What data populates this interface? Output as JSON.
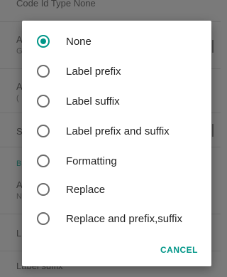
{
  "background": {
    "items": [
      {
        "title": "Code Id Type None",
        "subtitle": ""
      },
      {
        "title": "A",
        "subtitle": "G"
      },
      {
        "title": "A",
        "subtitle": "("
      },
      {
        "title": "S",
        "subtitle": ""
      },
      {
        "title": "B",
        "subtitle": ""
      },
      {
        "title": "A",
        "subtitle": "N"
      },
      {
        "title": "L",
        "subtitle": ""
      },
      {
        "title": "Label suffix",
        "subtitle": ""
      }
    ]
  },
  "dialog": {
    "selected_index": 0,
    "options": [
      {
        "label": "None"
      },
      {
        "label": "Label prefix"
      },
      {
        "label": "Label suffix"
      },
      {
        "label": "Label prefix and suffix"
      },
      {
        "label": "Formatting"
      },
      {
        "label": "Replace"
      },
      {
        "label": "Replace and prefix,suffix"
      }
    ],
    "cancel_label": "CANCEL"
  },
  "colors": {
    "accent": "#009688",
    "scrim": "#7a7a7a",
    "dialog_bg": "#ffffff"
  }
}
